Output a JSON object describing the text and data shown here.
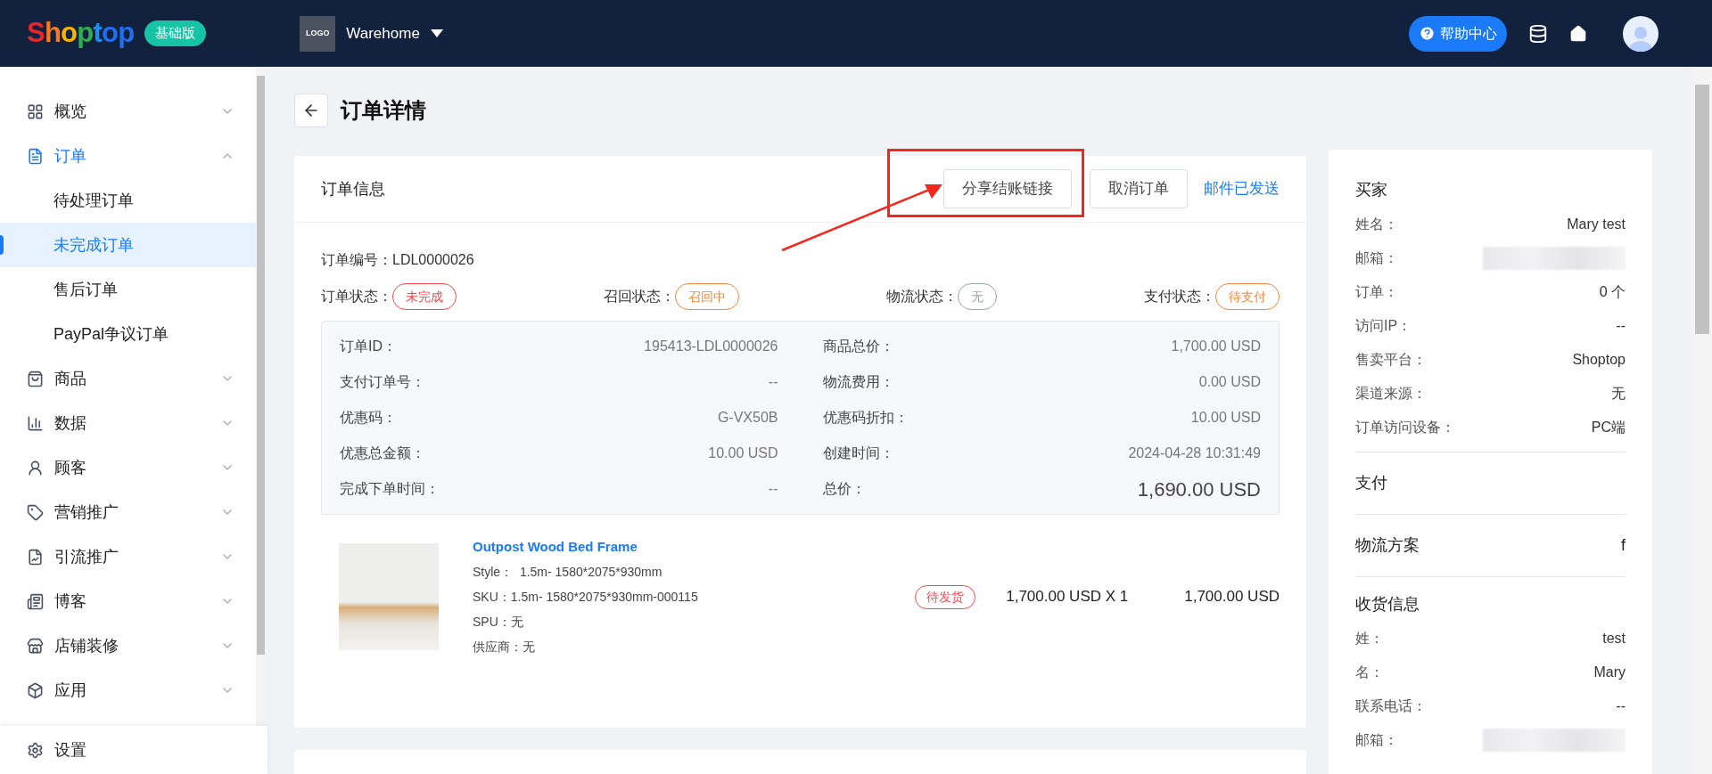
{
  "header": {
    "logo": "Shoptop",
    "edition": "基础版",
    "store_logo": "LOGO",
    "store_name": "Warehome",
    "help": "帮助中心"
  },
  "sidebar": {
    "items": [
      {
        "label": "概览",
        "selected": false,
        "expanded": false
      },
      {
        "label": "订单",
        "selected": true,
        "expanded": true,
        "children": [
          {
            "label": "待处理订单",
            "selected": false
          },
          {
            "label": "未完成订单",
            "selected": true
          },
          {
            "label": "售后订单",
            "selected": false
          },
          {
            "label": "PayPal争议订单",
            "selected": false
          }
        ]
      },
      {
        "label": "商品",
        "selected": false,
        "expanded": false
      },
      {
        "label": "数据",
        "selected": false,
        "expanded": false
      },
      {
        "label": "顾客",
        "selected": false,
        "expanded": false
      },
      {
        "label": "营销推广",
        "selected": false,
        "expanded": false
      },
      {
        "label": "引流推广",
        "selected": false,
        "expanded": false
      },
      {
        "label": "博客",
        "selected": false,
        "expanded": false
      },
      {
        "label": "店铺装修",
        "selected": false,
        "expanded": false
      },
      {
        "label": "应用",
        "selected": false,
        "expanded": false
      }
    ],
    "footer": "设置"
  },
  "page": {
    "title": "订单详情"
  },
  "order_card": {
    "title": "订单信息",
    "actions": [
      "分享结账链接",
      "取消订单"
    ],
    "email_status": "邮件已发送",
    "order_number": "订单编号：LDL0000026",
    "statuses": [
      {
        "label": "订单状态：",
        "value": "未完成",
        "color": "#f5484d"
      },
      {
        "label": "召回状态：",
        "value": "召回中",
        "color": "#f5873b"
      },
      {
        "label": "物流状态：",
        "value": "无",
        "color": "#9aa3b2"
      },
      {
        "label": "支付状态：",
        "value": "待支付",
        "color": "#f5873b"
      }
    ],
    "details_left": [
      {
        "label": "订单ID：",
        "value": "195413-LDL0000026",
        "emphasis": false
      },
      {
        "label": "支付订单号：",
        "value": "--",
        "emphasis": false
      },
      {
        "label": "优惠码：",
        "value": "G-VX50B",
        "emphasis": false
      },
      {
        "label": "优惠总金额：",
        "value": "10.00 USD",
        "emphasis": false
      },
      {
        "label": "完成下单时间：",
        "value": "--",
        "emphasis": false
      }
    ],
    "details_right": [
      {
        "label": "商品总价：",
        "value": "1,700.00 USD",
        "emphasis": false
      },
      {
        "label": "物流费用：",
        "value": "0.00 USD",
        "emphasis": false
      },
      {
        "label": "优惠码折扣：",
        "value": "10.00 USD",
        "emphasis": false
      },
      {
        "label": "创建时间：",
        "value": "2024-04-28 10:31:49",
        "emphasis": false
      },
      {
        "label": "总价：",
        "value": "1,690.00 USD",
        "emphasis": true
      }
    ],
    "product": {
      "name": "Outpost Wood Bed Frame",
      "attributes": [
        "Style：  1.5m- 1580*2075*930mm",
        "SKU：1.5m- 1580*2075*930mm-000115",
        "SPU：无",
        "供应商：无"
      ],
      "status": "待发货",
      "price": "1,700.00 USD X 1",
      "total": "1,700.00 USD"
    }
  },
  "side_panel": {
    "buyer": {
      "title": "买家",
      "rows": [
        {
          "label": "姓名：",
          "value": "Mary test",
          "redacted": false
        },
        {
          "label": "邮箱：",
          "redacted": true
        },
        {
          "label": "订单：",
          "value": "0 个",
          "redacted": false
        },
        {
          "label": "访问IP：",
          "value": "--",
          "redacted": false
        },
        {
          "label": "售卖平台：",
          "value": "Shoptop",
          "redacted": false
        },
        {
          "label": "渠道来源：",
          "value": "无",
          "redacted": false
        },
        {
          "label": "订单访问设备：",
          "value": "PC端",
          "redacted": false
        }
      ]
    },
    "payment": {
      "title": "支付"
    },
    "shipping": {
      "title": "物流方案",
      "value": "f"
    },
    "receiving": {
      "title": "收货信息",
      "rows": [
        {
          "label": "姓：",
          "value": "test",
          "redacted": false
        },
        {
          "label": "名：",
          "value": "Mary",
          "redacted": false
        },
        {
          "label": "联系电话：",
          "value": "--",
          "redacted": false
        },
        {
          "label": "邮箱：",
          "redacted": true
        }
      ]
    }
  }
}
